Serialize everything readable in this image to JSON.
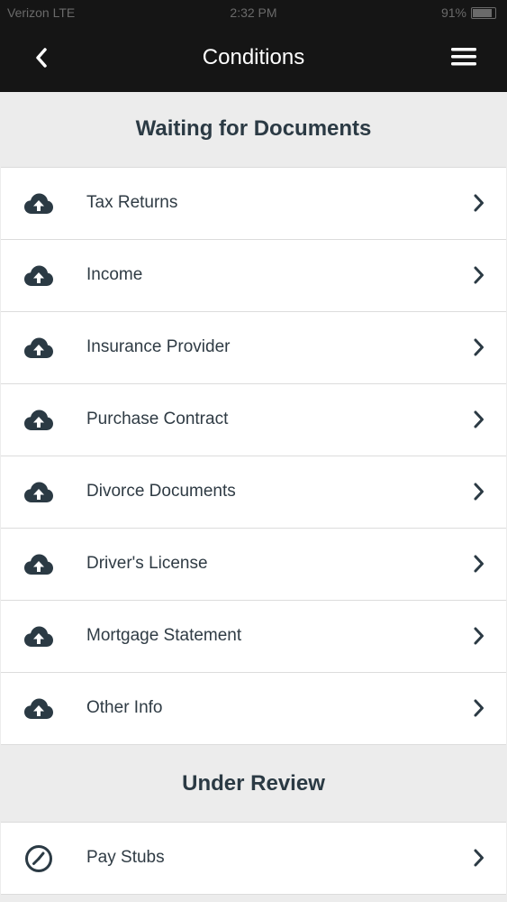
{
  "status_bar": {
    "carrier": "Verizon LTE",
    "time": "2:32 PM",
    "battery": "91%"
  },
  "header": {
    "title": "Conditions",
    "back_icon": "chevron-left-icon",
    "menu_icon": "hamburger-menu-icon"
  },
  "sections": [
    {
      "title": "Waiting for Documents",
      "items": [
        {
          "label": "Tax Returns",
          "icon": "cloud-upload-icon"
        },
        {
          "label": "Income",
          "icon": "cloud-upload-icon"
        },
        {
          "label": "Insurance Provider",
          "icon": "cloud-upload-icon"
        },
        {
          "label": "Purchase Contract",
          "icon": "cloud-upload-icon"
        },
        {
          "label": "Divorce Documents",
          "icon": "cloud-upload-icon"
        },
        {
          "label": "Driver's License",
          "icon": "cloud-upload-icon"
        },
        {
          "label": "Mortgage Statement",
          "icon": "cloud-upload-icon"
        },
        {
          "label": "Other Info",
          "icon": "cloud-upload-icon"
        }
      ]
    },
    {
      "title": "Under Review",
      "items": [
        {
          "label": "Pay Stubs",
          "icon": "clock-icon"
        }
      ]
    }
  ],
  "colors": {
    "header_bg": "#151515",
    "page_bg": "#ececec",
    "text_dark": "#2b3a44"
  }
}
